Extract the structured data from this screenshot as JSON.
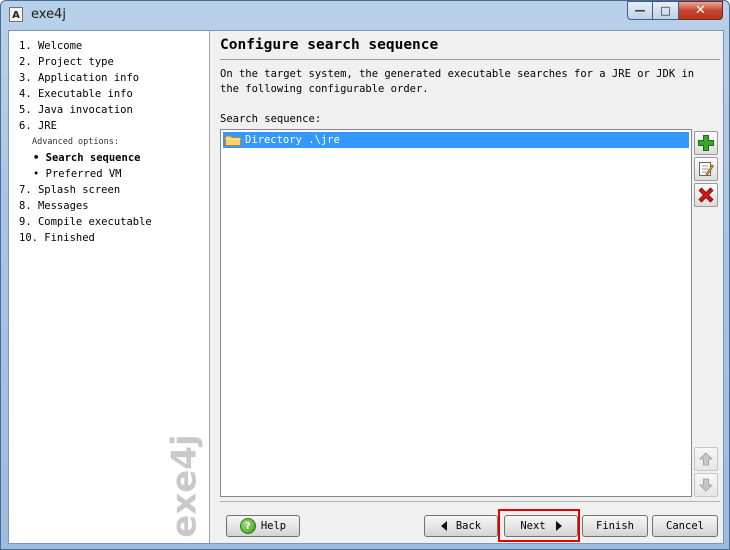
{
  "window": {
    "title": "exe4j",
    "app_icon_glyph": "A",
    "controls": {
      "minimize": "—",
      "maximize": "□",
      "close": "✕"
    }
  },
  "sidebar": {
    "steps": [
      {
        "label": "1. Welcome"
      },
      {
        "label": "2. Project type"
      },
      {
        "label": "3. Application info"
      },
      {
        "label": "4. Executable info"
      },
      {
        "label": "5. Java invocation"
      },
      {
        "label": "6. JRE"
      }
    ],
    "advanced_caption": "Advanced options:",
    "sub_steps": [
      {
        "label": "• Search sequence",
        "active": true
      },
      {
        "label": "• Preferred VM",
        "active": false
      }
    ],
    "more_steps": [
      {
        "label": "7. Splash screen"
      },
      {
        "label": "8. Messages"
      },
      {
        "label": "9. Compile executable"
      },
      {
        "label": "10. Finished"
      }
    ],
    "watermark": "exe4j"
  },
  "main": {
    "title": "Configure search sequence",
    "description": "On the target system, the generated executable searches for a JRE or JDK in the following configurable order.",
    "search_label": "Search sequence:",
    "entries": [
      {
        "label": "Directory .\\jre",
        "selected": true,
        "icon": "folder-icon"
      }
    ],
    "side_buttons": [
      {
        "name": "add-entry-button",
        "icon": "plus-icon"
      },
      {
        "name": "edit-entry-button",
        "icon": "edit-icon"
      },
      {
        "name": "remove-entry-button",
        "icon": "red-x-icon"
      },
      {
        "name": "move-up-button",
        "icon": "arrow-up-icon"
      },
      {
        "name": "move-down-button",
        "icon": "arrow-down-icon"
      }
    ]
  },
  "buttons": {
    "help": "Help",
    "back": "Back",
    "next": "Next",
    "finish": "Finish",
    "cancel": "Cancel"
  },
  "colors": {
    "selection": "#3399ff",
    "highlight": "#e60000",
    "plus_green": "#3aa32a",
    "remove_red": "#d21414"
  }
}
